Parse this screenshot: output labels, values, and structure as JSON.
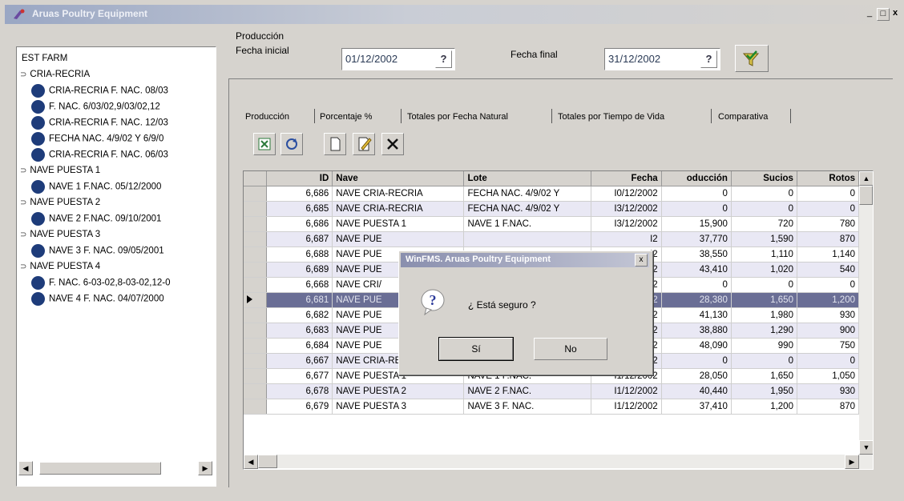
{
  "window": {
    "title": "Aruas Poultry Equipment"
  },
  "tree": {
    "root": "EST FARM",
    "items": [
      {
        "label": "CRIA-RECRIA",
        "kind": "folder"
      },
      {
        "label": "CRIA-RECRIA F. NAC. 08/03",
        "kind": "leaf"
      },
      {
        "label": "F. NAC. 6/03/02,9/03/02,12",
        "kind": "leaf"
      },
      {
        "label": "CRIA-RECRIA F. NAC. 12/03",
        "kind": "leaf"
      },
      {
        "label": "FECHA NAC. 4/9/02 Y 6/9/0",
        "kind": "leaf"
      },
      {
        "label": "CRIA-RECRIA F. NAC. 06/03",
        "kind": "leaf"
      },
      {
        "label": "NAVE PUESTA 1",
        "kind": "folder"
      },
      {
        "label": "NAVE 1 F.NAC. 05/12/2000",
        "kind": "leaf"
      },
      {
        "label": "NAVE PUESTA 2",
        "kind": "folder"
      },
      {
        "label": "NAVE 2 F.NAC. 09/10/2001",
        "kind": "leaf"
      },
      {
        "label": "NAVE PUESTA 3",
        "kind": "folder"
      },
      {
        "label": "NAVE 3 F. NAC. 09/05/2001",
        "kind": "leaf"
      },
      {
        "label": "NAVE PUESTA 4",
        "kind": "folder"
      },
      {
        "label": "F. NAC. 6-03-02,8-03-02,12-0",
        "kind": "leaf"
      },
      {
        "label": "NAVE 4 F. NAC. 04/07/2000",
        "kind": "leaf"
      }
    ]
  },
  "filters": {
    "heading": "Producción",
    "start_label": "Fecha inicial",
    "start_value": "01/12/2002",
    "end_label": "Fecha final",
    "end_value": "31/12/2002",
    "help_glyph": "?"
  },
  "tabs": [
    "Producción",
    "Porcentaje %",
    "Totales por Fecha Natural",
    "Totales por Tiempo de Vida",
    "Comparativa"
  ],
  "grid": {
    "columns": [
      "ID",
      "Nave",
      "Lote",
      "Fecha",
      "oducción",
      "Sucios",
      "Rotos"
    ],
    "rows": [
      [
        "6,686",
        "NAVE CRIA-RECRIA",
        "FECHA NAC. 4/9/02 Y",
        "I0/12/2002",
        "0",
        "0",
        "0"
      ],
      [
        "6,685",
        "NAVE CRIA-RECRIA",
        "FECHA NAC. 4/9/02 Y",
        "I3/12/2002",
        "0",
        "0",
        "0"
      ],
      [
        "6,686",
        "NAVE PUESTA 1",
        "NAVE 1 F.NAC.",
        "I3/12/2002",
        "15,900",
        "720",
        "780"
      ],
      [
        "6,687",
        "NAVE PUE",
        "",
        "I2",
        "37,770",
        "1,590",
        "870"
      ],
      [
        "6,688",
        "NAVE PUE",
        "",
        "I2",
        "38,550",
        "1,110",
        "1,140"
      ],
      [
        "6,689",
        "NAVE PUE",
        "",
        "I2",
        "43,410",
        "1,020",
        "540"
      ],
      [
        "6,668",
        "NAVE CRI/",
        "",
        "I2",
        "0",
        "0",
        "0"
      ],
      [
        "6,681",
        "NAVE PUE",
        "",
        "I2",
        "28,380",
        "1,650",
        "1,200"
      ],
      [
        "6,682",
        "NAVE PUE",
        "",
        "I2",
        "41,130",
        "1,980",
        "930"
      ],
      [
        "6,683",
        "NAVE PUE",
        "",
        "I2",
        "38,880",
        "1,290",
        "900"
      ],
      [
        "6,684",
        "NAVE PUE",
        "",
        "I2",
        "48,090",
        "990",
        "750"
      ],
      [
        "6,667",
        "NAVE CRIA-RECRIA",
        "FECHA NAC. 4/9/02 Y",
        "I1/12/2002",
        "0",
        "0",
        "0"
      ],
      [
        "6,677",
        "NAVE PUESTA 1",
        "NAVE 1 F.NAC.",
        "I1/12/2002",
        "28,050",
        "1,650",
        "1,050"
      ],
      [
        "6,678",
        "NAVE PUESTA 2",
        "NAVE 2 F.NAC.",
        "I1/12/2002",
        "40,440",
        "1,950",
        "930"
      ],
      [
        "6,679",
        "NAVE PUESTA 3",
        "NAVE 3 F. NAC.",
        "I1/12/2002",
        "37,410",
        "1,200",
        "870"
      ]
    ],
    "current_row": 7
  },
  "dialog": {
    "title": "WinFMS. Aruas Poultry Equipment",
    "message": "¿ Está seguro ?",
    "yes": "Sí",
    "no": "No",
    "close": "x"
  },
  "colors": {
    "selected_row": "#6a6e95",
    "alt_row": "#e9e8f4",
    "tree_dot": "#1e3c7a"
  }
}
